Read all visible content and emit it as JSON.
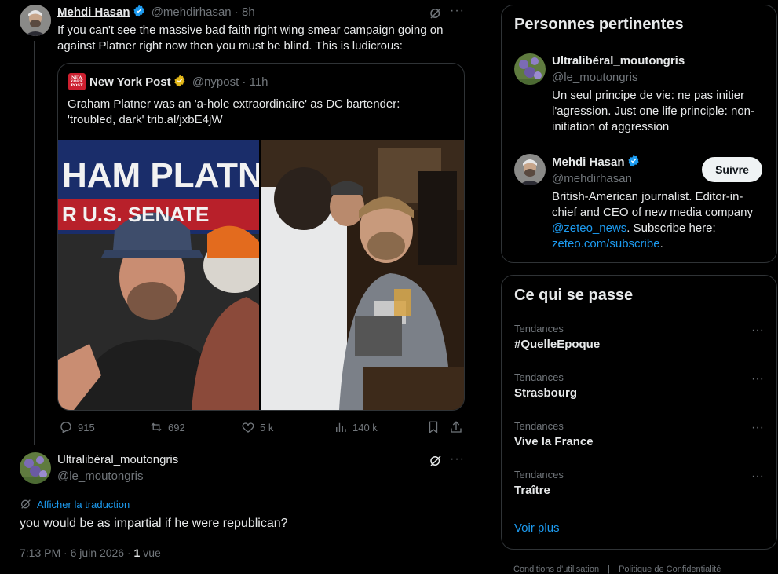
{
  "main_tweet": {
    "author": "Mehdi Hasan",
    "handle": "@mehdirhasan",
    "time": "8h",
    "text_line1": "If you can't see the massive bad faith right wing smear campaign going on",
    "text_line2": "against Platner right now then you must be blind. This is ludicrous:",
    "quote": {
      "author": "New York Post",
      "handle": "@nypost",
      "time": "11h",
      "logo_text": "NEW YORK POST",
      "text_line1": "Graham Platner was an 'a-hole extraordinaire' as DC bartender:",
      "text_line2": "'troubled, dark' trib.al/jxbE4jW",
      "image_sign_text": "HAM PLATNER",
      "image_sign_sub": "R U.S. SENATE"
    },
    "actions": {
      "replies": "915",
      "reposts": "692",
      "likes": "5 k",
      "views": "140 k"
    }
  },
  "reply_tweet": {
    "author": "Ultralibéral_moutongris",
    "handle": "@le_moutongris",
    "translate_label": "Afficher la traduction",
    "text": "you would be as impartial if he were republican?",
    "timestamp": "7:13 PM · 6 juin 2026 ·",
    "views_count": "1",
    "views_label": "vue"
  },
  "relevant_people": {
    "title": "Personnes pertinentes",
    "people": [
      {
        "name": "Ultralibéral_moutongris",
        "handle": "@le_moutongris",
        "bio_line1": "Un seul principe de vie: ne pas initier",
        "bio_line2": "l'agression. Just one life principle: non-",
        "bio_line3": "initiation of aggression"
      },
      {
        "name": "Mehdi Hasan",
        "handle": "@mehdirhasan",
        "follow_label": "Suivre",
        "bio_line1": "British-American journalist. Editor-in-",
        "bio_line2": "chief and CEO of new media company",
        "bio_mention": "@zeteo_news",
        "bio_after_mention": ". Subscribe here:",
        "bio_link": "zeteo.com/subscribe",
        "bio_end": "."
      }
    ]
  },
  "trends": {
    "title": "Ce qui se passe",
    "items": [
      {
        "category": "Tendances",
        "name": "#QuelleEpoque"
      },
      {
        "category": "Tendances",
        "name": "Strasbourg"
      },
      {
        "category": "Tendances",
        "name": "Vive la France"
      },
      {
        "category": "Tendances",
        "name": "Traître"
      }
    ],
    "show_more": "Voir plus"
  },
  "footer": {
    "terms": "Conditions d'utilisation",
    "privacy": "Politique de Confidentialité"
  },
  "colors": {
    "background": "#000000",
    "text": "#e7e9ea",
    "muted": "#71767b",
    "accent": "#1d9bf0",
    "verified_gold": "#e2b719",
    "nypost_red": "#cc1f2f"
  }
}
